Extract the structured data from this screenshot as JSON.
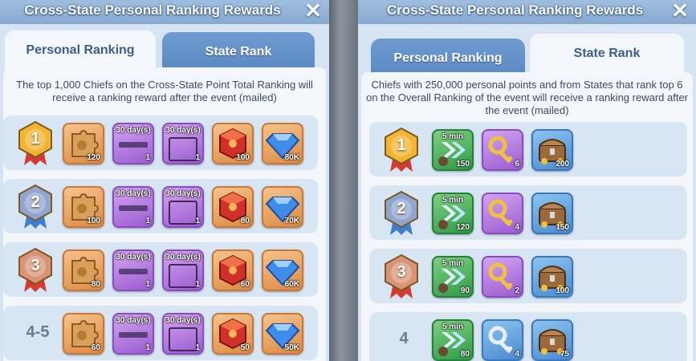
{
  "left": {
    "title": "Cross-State Personal Ranking Rewards",
    "close_label": "✕",
    "tabs": [
      {
        "label": "Personal Ranking",
        "active": true
      },
      {
        "label": "State Rank",
        "active": false
      }
    ],
    "description": "The top 1,000 Chiefs on the Cross-State Point Total Ranking will receive a ranking reward after the event (mailed)",
    "rows": [
      {
        "rank_badge": "gold-badge",
        "rank_label": "1",
        "items": [
          {
            "icon": "puzzle-piece-icon",
            "color": "orange",
            "qty": "120"
          },
          {
            "icon": "bar-30-days-icon",
            "color": "purple",
            "top": "30 day(s)",
            "qty": "1"
          },
          {
            "icon": "frame-30-days-icon",
            "color": "purple",
            "top": "30 day(s)",
            "qty": "1"
          },
          {
            "icon": "red-cube-icon",
            "color": "orange",
            "qty": "100"
          },
          {
            "icon": "diamond-icon",
            "color": "orange",
            "qty": "80K"
          }
        ]
      },
      {
        "rank_badge": "silver-badge",
        "rank_label": "2",
        "items": [
          {
            "icon": "puzzle-piece-icon",
            "color": "orange",
            "qty": "100"
          },
          {
            "icon": "bar-30-days-icon",
            "color": "purple",
            "top": "30 day(s)",
            "qty": "1"
          },
          {
            "icon": "frame-30-days-icon",
            "color": "purple",
            "top": "30 day(s)",
            "qty": "1"
          },
          {
            "icon": "red-cube-icon",
            "color": "orange",
            "qty": "80"
          },
          {
            "icon": "diamond-icon",
            "color": "orange",
            "qty": "70K"
          }
        ]
      },
      {
        "rank_badge": "bronze-badge",
        "rank_label": "3",
        "items": [
          {
            "icon": "puzzle-piece-icon",
            "color": "orange",
            "qty": "80"
          },
          {
            "icon": "bar-30-days-icon",
            "color": "purple",
            "top": "30 day(s)",
            "qty": "1"
          },
          {
            "icon": "frame-30-days-icon",
            "color": "purple",
            "top": "30 day(s)",
            "qty": "1"
          },
          {
            "icon": "red-cube-icon",
            "color": "orange",
            "qty": "60"
          },
          {
            "icon": "diamond-icon",
            "color": "orange",
            "qty": "60K"
          }
        ]
      },
      {
        "rank_badge": "",
        "rank_label": "4-5",
        "items": [
          {
            "icon": "puzzle-piece-icon",
            "color": "orange",
            "qty": "60"
          },
          {
            "icon": "bar-30-days-icon",
            "color": "purple",
            "top": "30 day(s)",
            "qty": "1"
          },
          {
            "icon": "frame-30-days-icon",
            "color": "purple",
            "top": "30 day(s)",
            "qty": "1"
          },
          {
            "icon": "red-cube-icon",
            "color": "orange",
            "qty": "50"
          },
          {
            "icon": "diamond-icon",
            "color": "orange",
            "qty": "50K"
          }
        ]
      }
    ]
  },
  "right": {
    "title": "Cross-State Personal Ranking Rewards",
    "close_label": "✕",
    "tabs": [
      {
        "label": "Personal Ranking",
        "active": false
      },
      {
        "label": "State Rank",
        "active": true
      }
    ],
    "description": "Chiefs with 250,000 personal points and from States that rank top 6 on the Overall Ranking of the event will receive a ranking reward after the event (mailed)",
    "rows": [
      {
        "rank_badge": "gold-badge",
        "rank_label": "1",
        "items": [
          {
            "icon": "speedup-arrow-icon",
            "color": "green",
            "top": "5 min",
            "qty": "150"
          },
          {
            "icon": "gold-key-icon",
            "color": "purple",
            "qty": "6"
          },
          {
            "icon": "treasure-chest-icon",
            "color": "blue",
            "qty": "200"
          }
        ]
      },
      {
        "rank_badge": "silver-badge",
        "rank_label": "2",
        "items": [
          {
            "icon": "speedup-arrow-icon",
            "color": "green",
            "top": "5 min",
            "qty": "120"
          },
          {
            "icon": "gold-key-icon",
            "color": "purple",
            "qty": "4"
          },
          {
            "icon": "treasure-chest-icon",
            "color": "blue",
            "qty": "150"
          }
        ]
      },
      {
        "rank_badge": "bronze-badge",
        "rank_label": "3",
        "items": [
          {
            "icon": "speedup-arrow-icon",
            "color": "green",
            "top": "5 min",
            "qty": "90"
          },
          {
            "icon": "gold-key-icon",
            "color": "purple",
            "qty": "2"
          },
          {
            "icon": "treasure-chest-icon",
            "color": "blue",
            "qty": "100"
          }
        ]
      },
      {
        "rank_badge": "",
        "rank_label": "4",
        "items": [
          {
            "icon": "speedup-arrow-icon",
            "color": "green",
            "top": "5 min",
            "qty": "80"
          },
          {
            "icon": "silver-key-icon",
            "color": "blue",
            "qty": "4"
          },
          {
            "icon": "treasure-chest-icon",
            "color": "blue",
            "qty": "75"
          }
        ]
      }
    ]
  },
  "colors": {
    "gold": "#f2b431",
    "silver": "#8fa6d0",
    "bronze": "#d99477",
    "ribbon_red": "#d23a32",
    "ribbon_blue": "#3f7fd0"
  }
}
